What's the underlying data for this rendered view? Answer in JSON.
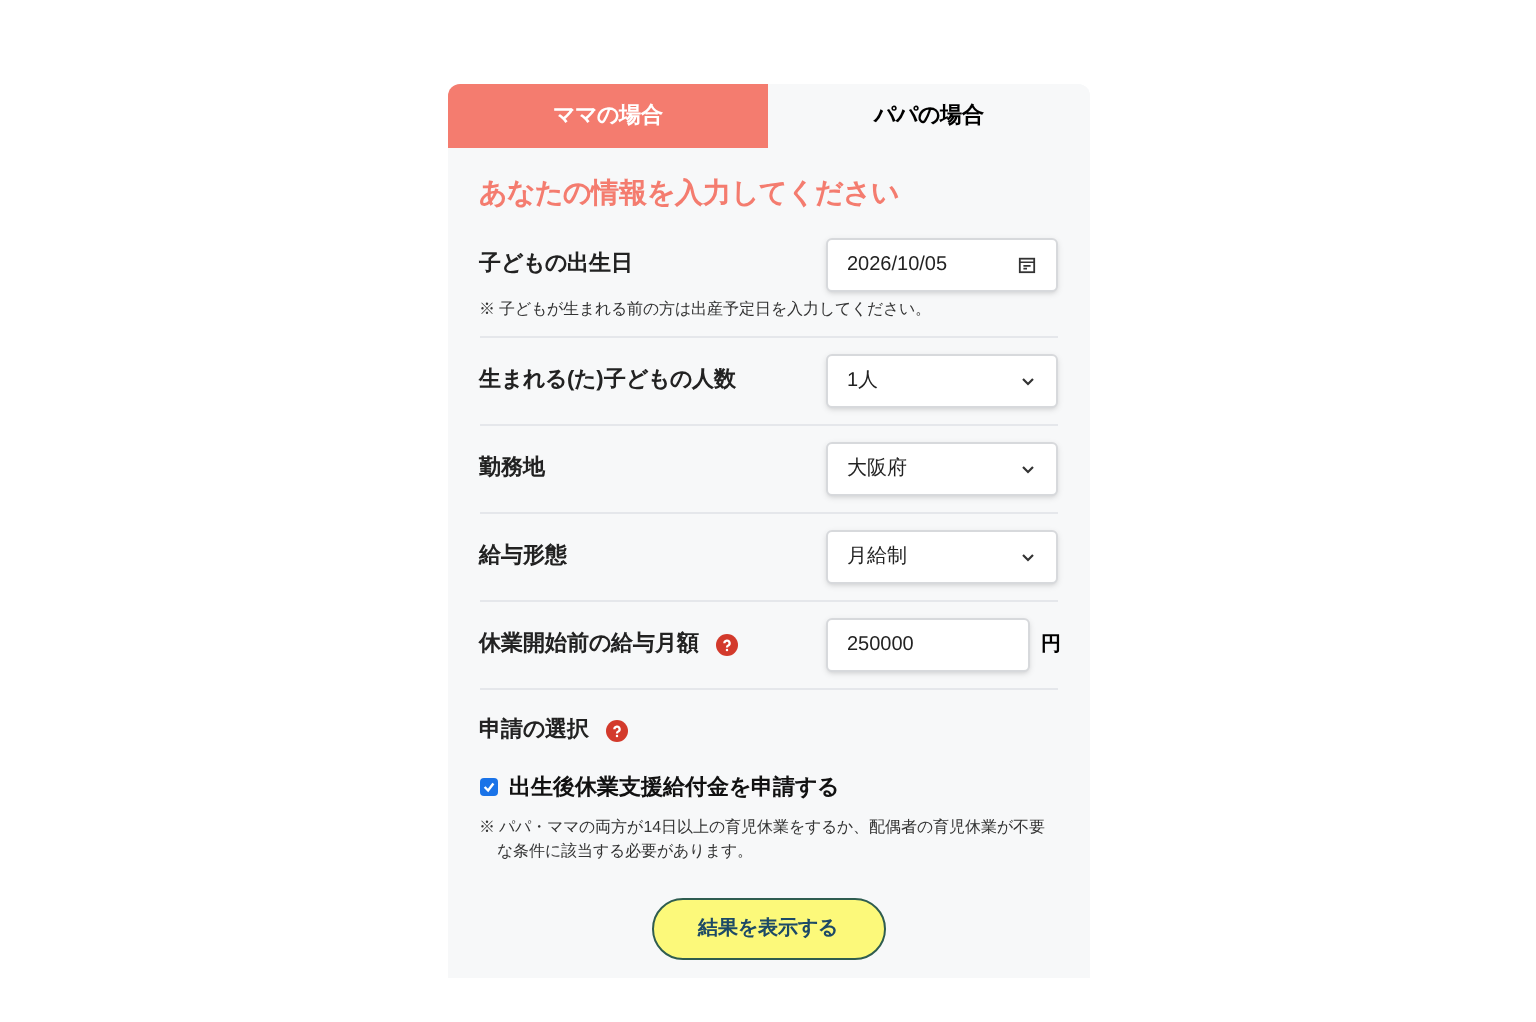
{
  "tabs": [
    {
      "label": "ママの場合",
      "selected": true
    },
    {
      "label": "パパの場合",
      "selected": false
    }
  ],
  "heading": "あなたの情報を入力してください",
  "fields": [
    {
      "kind": "date",
      "label": "子どもの出生日",
      "value": "2026/10/05",
      "note": "※ 子どもが生まれる前の方は出産予定日を入力してください。"
    },
    {
      "kind": "select",
      "label": "生まれる(た)子どもの人数",
      "value": "1人"
    },
    {
      "kind": "select",
      "label": "勤務地",
      "value": "大阪府"
    },
    {
      "kind": "select",
      "label": "給与形態",
      "value": "月給制"
    },
    {
      "kind": "text",
      "label": "休業開始前の給与月額",
      "help": true,
      "value": "250000",
      "unit": "円"
    }
  ],
  "application": {
    "label": "申請の選択",
    "help": true,
    "option": {
      "label": "出生後休業支援給付金を申請する",
      "checked": true
    },
    "note": "※ パパ・ママの両方が14日以上の育児休業をするか、配偶者の育児休業が不要な条件に該当する必要があります。"
  },
  "submit": "結果を表示する"
}
